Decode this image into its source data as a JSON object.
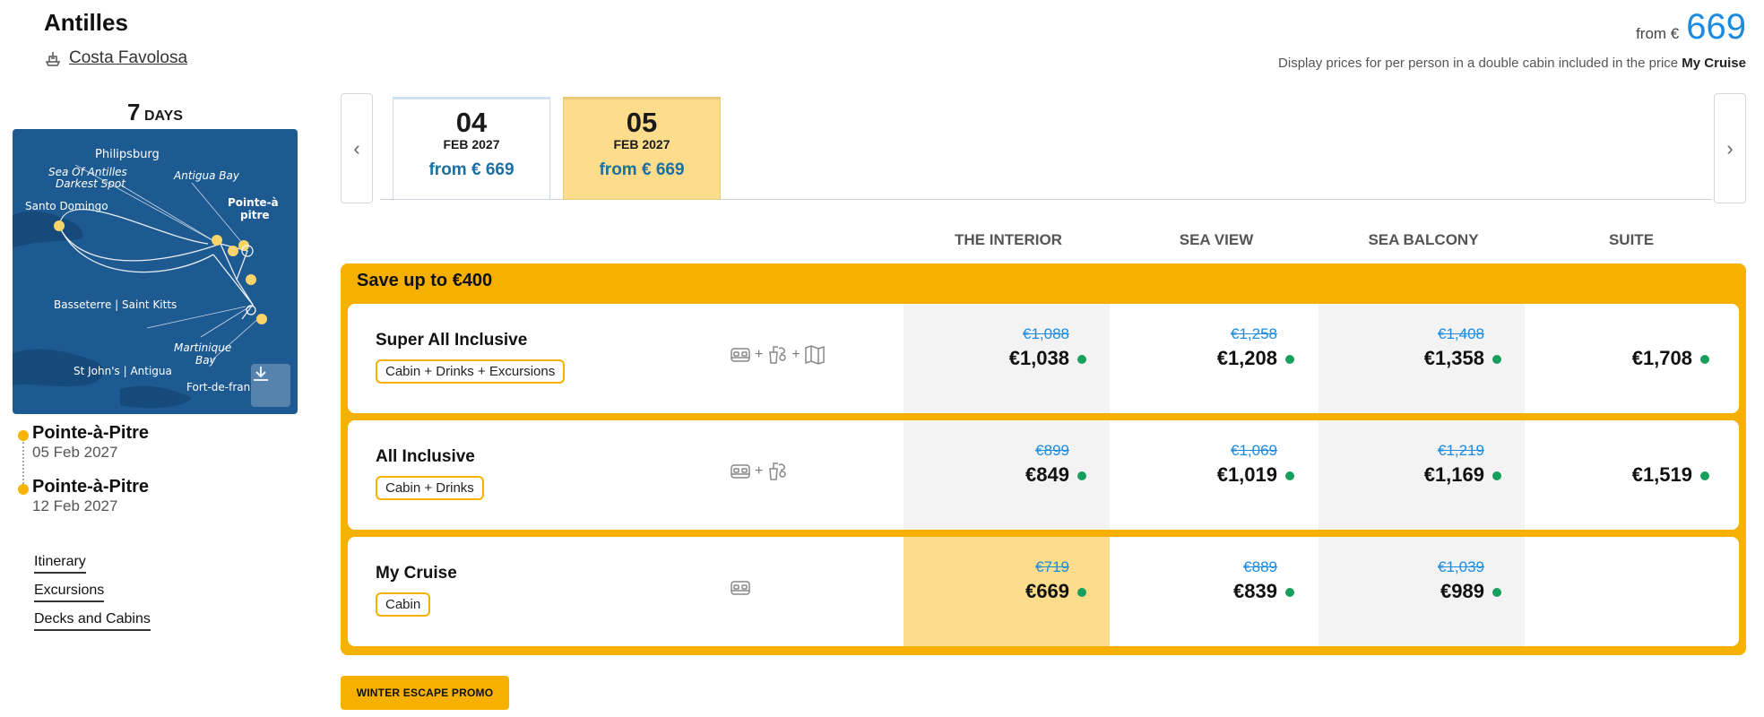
{
  "header": {
    "title": "Antilles",
    "ship_name": "Costa Favolosa",
    "from_label": "from €",
    "from_price": "669",
    "note_text": "Display prices for per person in a double cabin included in the price",
    "note_bold": "My Cruise"
  },
  "itinerary": {
    "days_num": "7",
    "days_label": "DAYS",
    "map_labels": {
      "philipsburg": "Philipsburg",
      "sea_of_antilles_1": "Sea Of Antilles",
      "sea_of_antilles_2": "Darkest Spot",
      "antigua_bay": "Antigua Bay",
      "pointe_a_pitre_1": "Pointe-à",
      "pointe_a_pitre_2": "pitre",
      "santo_domingo": "Santo Domingo",
      "basseterre": "Basseterre | Saint Kitts",
      "martinique_1": "Martinique",
      "martinique_2": "Bay",
      "st_johns": "St John's | Antigua",
      "fort_de_france": "Fort-de-fran"
    },
    "departure": {
      "port": "Pointe-à-Pitre",
      "date": "05 Feb 2027"
    },
    "arrival": {
      "port": "Pointe-à-Pitre",
      "date": "12 Feb 2027"
    }
  },
  "sidebar_links": [
    "Itinerary",
    "Excursions",
    "Decks and Cabins"
  ],
  "date_tabs": [
    {
      "day": "04",
      "month": "FEB 2027",
      "from": "from € 669",
      "active": false
    },
    {
      "day": "05",
      "month": "FEB 2027",
      "from": "from € 669",
      "active": true
    }
  ],
  "columns": [
    "THE INTERIOR",
    "SEA VIEW",
    "SEA BALCONY",
    "SUITE"
  ],
  "offer": {
    "save_text": "Save up to €400",
    "packages": [
      {
        "name": "Super All Inclusive",
        "tag": "Cabin + Drinks + Excursions",
        "prices": [
          {
            "old": "€1,088",
            "current": "€1,038"
          },
          {
            "old": "€1,258",
            "current": "€1,208"
          },
          {
            "old": "€1,408",
            "current": "€1,358"
          },
          {
            "old": "",
            "current": "€1,708"
          }
        ]
      },
      {
        "name": "All Inclusive",
        "tag": "Cabin + Drinks",
        "prices": [
          {
            "old": "€899",
            "current": "€849"
          },
          {
            "old": "€1,069",
            "current": "€1,019"
          },
          {
            "old": "€1,219",
            "current": "€1,169"
          },
          {
            "old": "",
            "current": "€1,519"
          }
        ]
      },
      {
        "name": "My Cruise",
        "tag": "Cabin",
        "prices": [
          {
            "old": "€719",
            "current": "€669"
          },
          {
            "old": "€889",
            "current": "€839"
          },
          {
            "old": "€1,039",
            "current": "€989"
          }
        ]
      }
    ]
  },
  "promo_label": "WINTER ESCAPE PROMO",
  "icons": {
    "ship": "ship-icon",
    "bed": "bed-icon",
    "drinks": "drinks-icon",
    "map": "map-icon",
    "download": "download-icon",
    "prev": "chevron-left-icon",
    "next": "chevron-right-icon"
  },
  "colors": {
    "accent": "#f6b100",
    "price_blue": "#1b8be0",
    "available_green": "#17a05d",
    "selected_cell": "#fddc8c"
  }
}
